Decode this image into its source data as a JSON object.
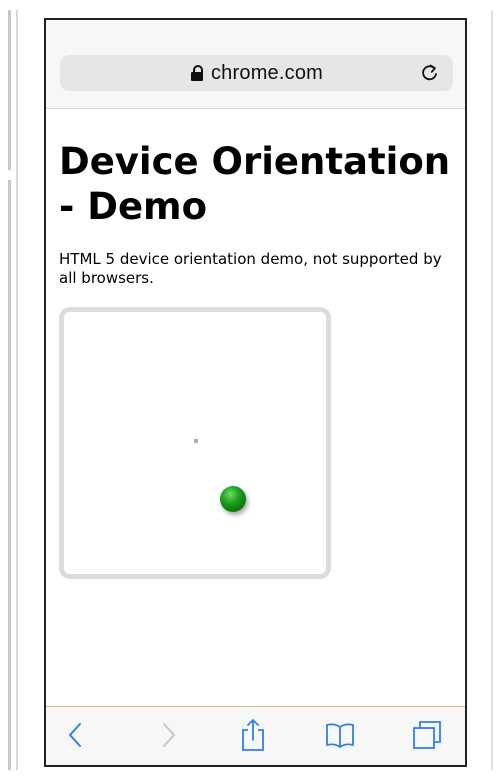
{
  "browser": {
    "url": "chrome.com"
  },
  "page": {
    "title": "Device Orientation - Demo",
    "description": "HTML 5 device orientation demo, not supported by all browsers."
  },
  "demo": {
    "ball_color": "#1a8f1a",
    "box_border_color": "#dcdcdc"
  },
  "toolbar": {
    "icons": [
      "back-icon",
      "forward-icon",
      "share-icon",
      "bookmarks-icon",
      "tabs-icon"
    ],
    "accent_color": "#2f80ed",
    "disabled_color": "#c7c7cc"
  }
}
